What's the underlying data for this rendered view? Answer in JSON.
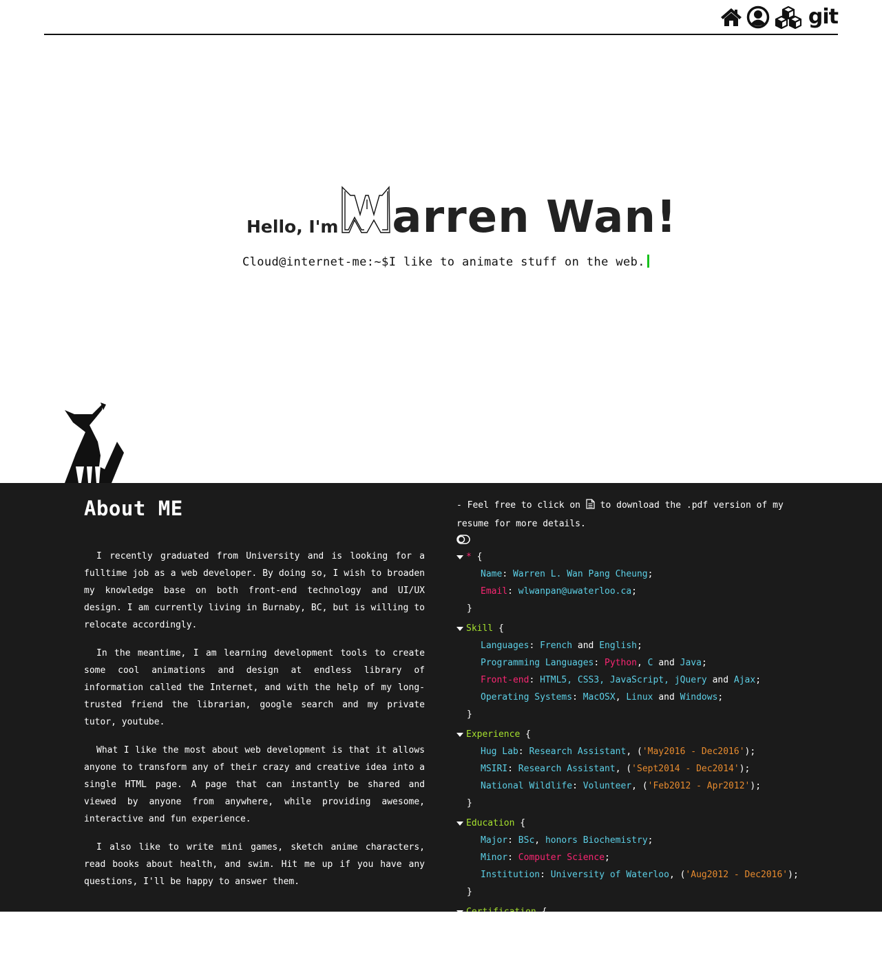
{
  "nav": {
    "home_icon": "home-icon",
    "profile_icon": "user-circle-icon",
    "projects_icon": "cubes-icon",
    "git_label": "git"
  },
  "hero": {
    "greeting": "Hello, I'm",
    "name": "arren Wan!",
    "logo_letter": "W",
    "prompt": "Cloud@internet-me:~$",
    "tagline": "I like to animate stuff on the web."
  },
  "about": {
    "title": "About ME",
    "paragraphs": [
      "I recently graduated from University and is looking for a fulltime job as a web developer. By doing so, I wish to broaden my knowledge base on both front-end technology and UI/UX design. I am currently living in Burnaby, BC, but is willing to relocate accordingly.",
      "In the meantime, I am learning development tools to create some cool animations and design at endless library of information called the Internet, and with the help of my long-trusted friend the librarian, google search and my private tutor, youtube.",
      "What I like the most about web development is that it allows anyone to transform any of their crazy and creative idea into a single HTML page. A page that can instantly be shared and viewed by anyone from anywhere, while providing awesome, interactive and fun experience.",
      "I also like to write mini games, sketch anime characters, read books about health, and swim. Hit me up if you have any questions, I'll be happy to answer them."
    ]
  },
  "resume": {
    "intro_before": "- Feel free to click on",
    "intro_after": "to download the .pdf version of my resume for more details.",
    "star": {
      "selector": "*",
      "name_key": "Name",
      "name_val": "Warren L. Wan Pang Cheung",
      "email_key": "Email",
      "email_val": "wlwanpan@uwaterloo.ca"
    },
    "skill": {
      "selector": "Skill",
      "lang_key": "Languages",
      "lang_v1": "French",
      "lang_and": "and",
      "lang_v2": "English",
      "prog_key": "Programming Languages",
      "prog_v1": "Python",
      "prog_v2": "C",
      "prog_and": "and",
      "prog_v3": "Java",
      "fe_key": "Front-end",
      "fe_vals": "HTML5, CSS3, JavaScript, jQuery",
      "fe_and": "and",
      "fe_last": "Ajax",
      "os_key": "Operating Systems",
      "os_v1": "MacOSX",
      "os_v2": "Linux",
      "os_and": "and",
      "os_v3": "Windows"
    },
    "experience": {
      "selector": "Experience",
      "rows": [
        {
          "key": "Hug Lab",
          "role": "Research Assistant",
          "dates": "'May2016 - Dec2016'"
        },
        {
          "key": "MSIRI",
          "role": "Research Assistant",
          "dates": "'Sept2014 - Dec2014'"
        },
        {
          "key": "National Wildlife",
          "role": "Volunteer",
          "dates": "'Feb2012 - Apr2012'"
        }
      ]
    },
    "education": {
      "selector": "Education",
      "major_key": "Major",
      "major_v1": "BSc",
      "major_v2": "honors Biochemistry",
      "minor_key": "Minor",
      "minor_val": "Computer Science",
      "inst_key": "Institution",
      "inst_val": "University of Waterloo",
      "inst_dates": "'Aug2012 - Dec2016'"
    },
    "certification": {
      "selector": "Certification"
    }
  },
  "colors": {
    "dark_bg": "#1b1b1b",
    "cyan": "#5ccfe6",
    "pink": "#f92672",
    "orange": "#e88b2e",
    "green": "#a6e22e",
    "cursor": "#17c11c"
  }
}
